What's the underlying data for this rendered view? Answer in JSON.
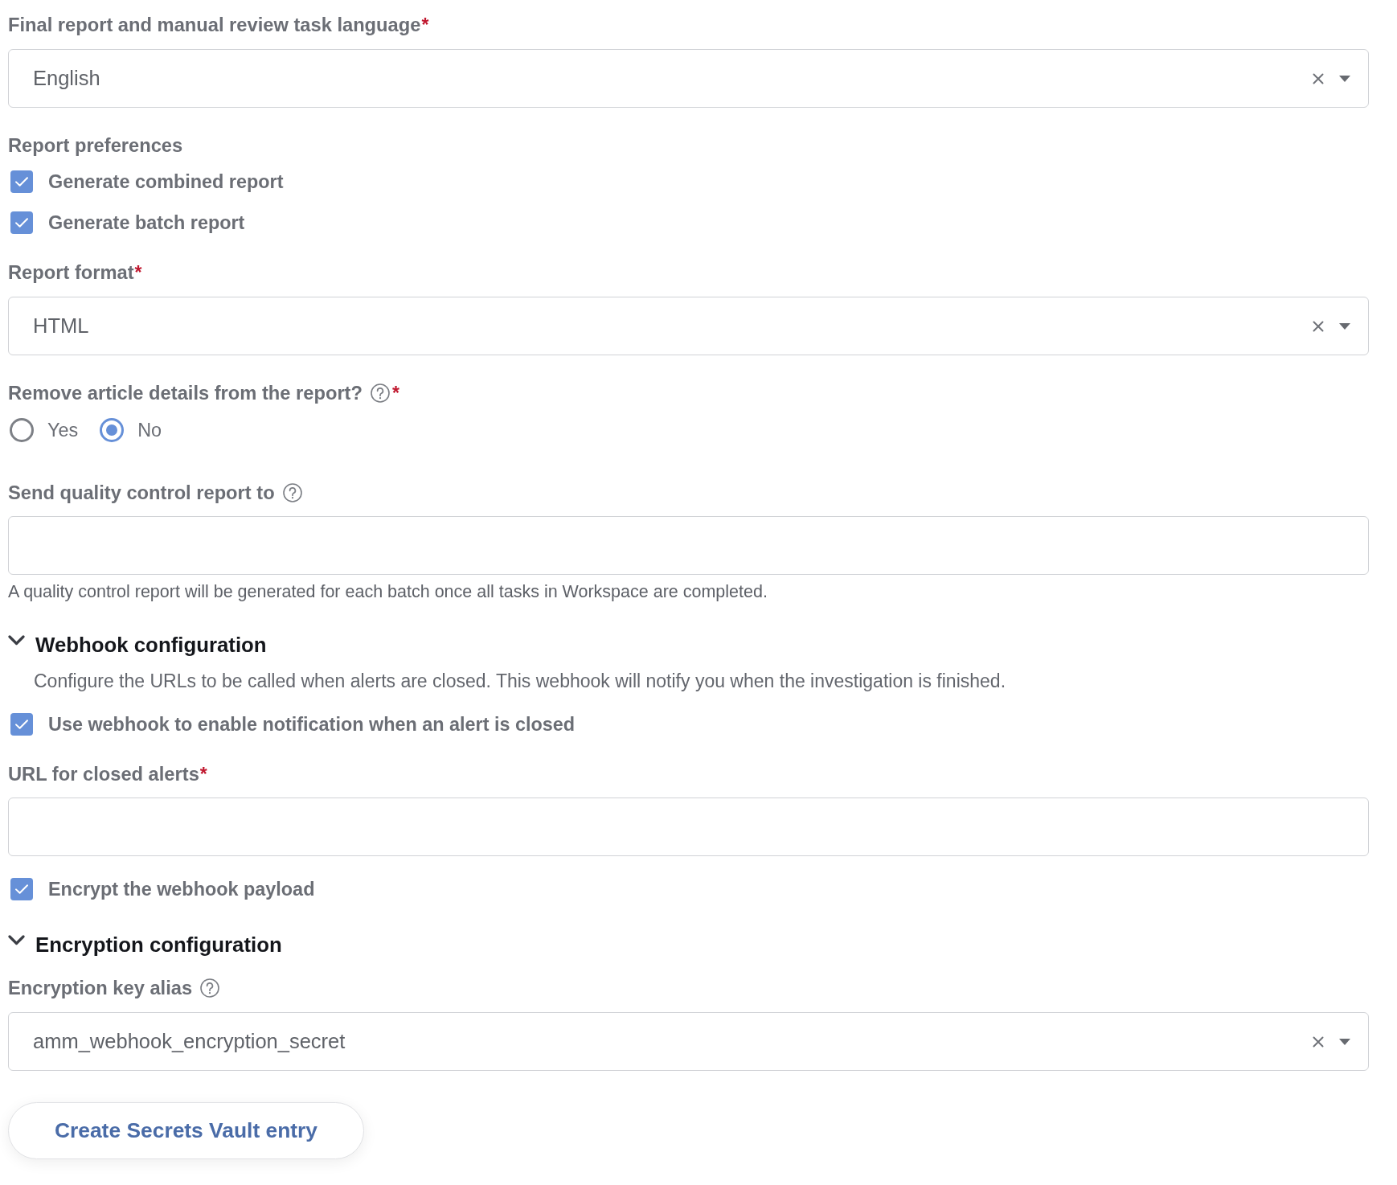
{
  "fields": [
    {
      "kind": "select",
      "label": "Final report and manual review task language",
      "required_mark": "*",
      "value": "English"
    },
    {
      "kind": "checkbox_group",
      "label": "Report preferences",
      "options": [
        {
          "label": "Generate combined report",
          "checked": true
        },
        {
          "label": "Generate batch report",
          "checked": true
        }
      ]
    },
    {
      "kind": "select",
      "label": "Report format",
      "required_mark": "*",
      "value": "HTML"
    },
    {
      "kind": "radio",
      "label": "Remove article details from the report?",
      "help": true,
      "required_mark": "*",
      "options": [
        {
          "label": "Yes",
          "selected": false
        },
        {
          "label": "No",
          "selected": true
        }
      ]
    },
    {
      "kind": "text",
      "label": "Send quality control report to",
      "help": true,
      "hint": "A quality control report will be generated for each batch once all tasks in Workspace are completed."
    }
  ],
  "sections": [
    {
      "title": "Webhook configuration",
      "expanded": true,
      "description": "Configure the URLs to be called when alerts are closed. This webhook will notify you when the investigation is finished.",
      "fields": [
        {
          "kind": "checkbox",
          "label": "Use webhook to enable notification when an alert is closed",
          "checked": true
        },
        {
          "kind": "text",
          "label": "URL for closed alerts",
          "required_mark": "*"
        },
        {
          "kind": "checkbox",
          "label": "Encrypt the webhook payload",
          "checked": true
        }
      ]
    },
    {
      "title": "Encryption configuration",
      "expanded": true,
      "fields": [
        {
          "kind": "select",
          "label": "Encryption key alias",
          "help": true,
          "value": "amm_webhook_encryption_secret"
        }
      ],
      "button": {
        "label": "Create Secrets Vault entry"
      }
    }
  ]
}
